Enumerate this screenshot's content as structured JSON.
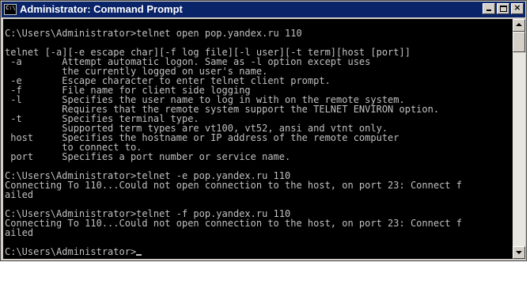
{
  "window": {
    "title": "Administrator: Command Prompt",
    "icon": "console-icon",
    "icon_text": "C:\\"
  },
  "titlebar_buttons": {
    "minimize": "minimize-icon",
    "maximize": "maximize-icon",
    "close": "close-icon",
    "close_glyph": "×"
  },
  "console": {
    "lines": [
      "",
      "C:\\Users\\Administrator>telnet open pop.yandex.ru 110",
      "",
      "telnet [-a][-e escape char][-f log file][-l user][-t term][host [port]]",
      " -a       Attempt automatic logon. Same as -l option except uses",
      "          the currently logged on user's name.",
      " -e       Escape character to enter telnet client prompt.",
      " -f       File name for client side logging",
      " -l       Specifies the user name to log in with on the remote system.",
      "          Requires that the remote system support the TELNET ENVIRON option.",
      " -t       Specifies terminal type.",
      "          Supported term types are vt100, vt52, ansi and vtnt only.",
      " host     Specifies the hostname or IP address of the remote computer",
      "          to connect to.",
      " port     Specifies a port number or service name.",
      "",
      "C:\\Users\\Administrator>telnet -e pop.yandex.ru 110",
      "Connecting To 110...Could not open connection to the host, on port 23: Connect f",
      "ailed",
      "",
      "C:\\Users\\Administrator>telnet -f pop.yandex.ru 110",
      "Connecting To 110...Could not open connection to the host, on port 23: Connect f",
      "ailed",
      "",
      "C:\\Users\\Administrator>"
    ]
  },
  "colors": {
    "titlebar": "#0a246a",
    "console_bg": "#000000",
    "console_fg": "#c0c0c0",
    "chrome": "#d4d0c8"
  }
}
